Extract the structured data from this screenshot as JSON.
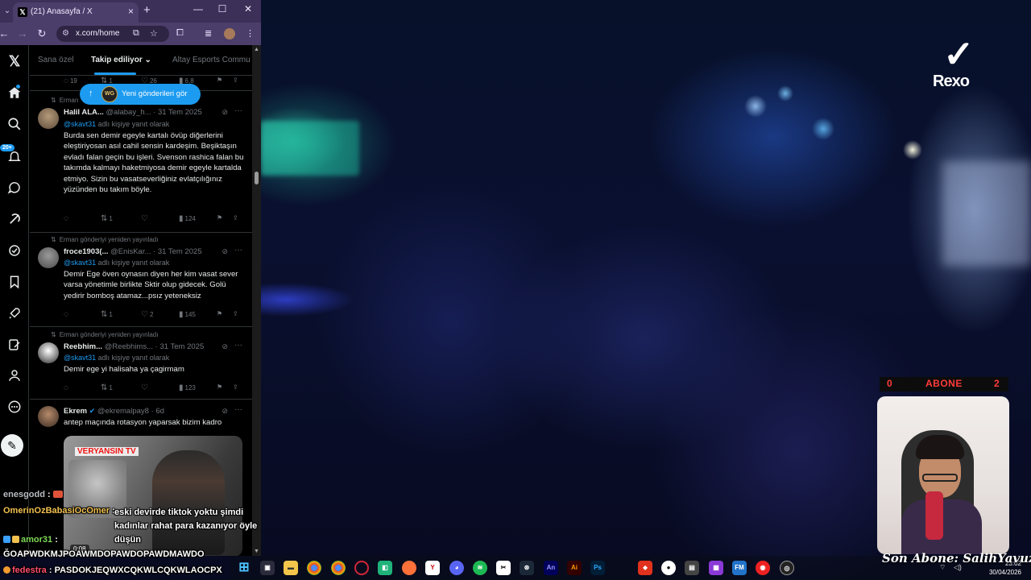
{
  "browser": {
    "tab_title": "(21) Anasayfa / X",
    "url": "x.com/home",
    "tab_favicon": "x-logo",
    "controls": {
      "new_tab": "+",
      "minimize": "—",
      "maximize": "☐",
      "close": "✕"
    }
  },
  "x": {
    "feed_tabs": [
      "Sana özel",
      "Takip ediliyor",
      "Altay Esports Commu"
    ],
    "active_tab": "Takip ediliyor",
    "notification_badge": "20+",
    "new_posts_pill": "Yeni gönderileri gör",
    "new_posts_avatar": "WG",
    "top_actions": {
      "replies": "19",
      "reposts": "1",
      "likes": "26",
      "views": "6,8"
    },
    "posts": [
      {
        "repost_by": "Erman",
        "name": "Halil ALA...",
        "handle": "@alabay_h...",
        "time": "31 Tem 2025",
        "reply_mention": "@skavt31",
        "reply_suffix": "adlı kişiye yanıt olarak",
        "text": "Burda sen demir egeyle kartalı övüp diğerlerini eleştiriyosan asıl cahil sensin kardeşim. Beşiktaşın evladı falan geçin bu işleri. Svenson rashica falan bu takımda kalmayı haketmiyosa demir egeyle kartalda etmiyo. Sizin bu vasatseverliğiniz evlatçılığınız yüzünden bu takım böyle.",
        "actions": {
          "replies": "",
          "reposts": "1",
          "likes": "",
          "views": "124"
        }
      },
      {
        "repost_by": "Erman gönderiyi yeniden yayınladı",
        "name": "froce1903(...",
        "handle": "@EnisKar...",
        "time": "31 Tem 2025",
        "reply_mention": "@skavt31",
        "reply_suffix": "adlı kişiye yanıt olarak",
        "text": "Demir Ege öven oynasın diyen her kim vasat sever varsa yönetimle birlikte Sktir olup gidecek. Golü yedirir bomboş atamaz...psız yeteneksiz",
        "actions": {
          "replies": "",
          "reposts": "1",
          "likes": "2",
          "views": "145"
        }
      },
      {
        "repost_by": "Erman gönderiyi yeniden yayınladı",
        "name": "Reebhim...",
        "handle": "@Reebhims...",
        "time": "31 Tem 2025",
        "reply_mention": "@skavt31",
        "reply_suffix": "adlı kişiye yanıt olarak",
        "text": "Demir ege yi halisaha ya çagirmam",
        "actions": {
          "replies": "",
          "reposts": "1",
          "likes": "",
          "views": "123"
        }
      },
      {
        "name": "Ekrem",
        "handle": "@ekremalpay8",
        "time": "6d",
        "text": "antep maçında rotasyon yaparsak bizim kadro",
        "media_logo": "VERYANSIN TV",
        "media_time": "0:08"
      }
    ]
  },
  "chat": [
    {
      "user": "enesgodd",
      "message": ""
    },
    {
      "user": "OmerinOzBabasiOcOmer",
      "message": "eski devirde tiktok yoktu şimdi kadınlar rahat para kazanıyor öyle düşün"
    },
    {
      "user": "amor31",
      "message": "ĞOAPWDKMJPOAWMDOPAWDOPAWDMAWDO"
    },
    {
      "user": "fedestra",
      "message": "PASDOKJEQWXCQKWLCQKWLAOCPX"
    }
  ],
  "stream": {
    "brand": "Rexo",
    "sub_counter": {
      "left": "0",
      "label": "ABONE",
      "right": "2"
    },
    "last_sub": "Son Abone: SalihYavuz"
  },
  "taskbar": {
    "time": "23:02",
    "date": "30/04/2026",
    "apps": [
      "windows-start",
      "file-explorer",
      "folder",
      "chrome",
      "chrome-alt",
      "opera",
      "app-green",
      "firefox",
      "app-y",
      "discord",
      "spotify",
      "capcut",
      "steam",
      "adobe-an",
      "adobe-ai",
      "adobe-ps",
      "acrobat",
      "app-ball",
      "video-editor",
      "app-purple",
      "app-fm",
      "app-red",
      "obs"
    ]
  },
  "colors": {
    "accent": "#1d9bf0",
    "browser_chrome": "#4c3e6a",
    "counter_red": "#ff3b3b"
  }
}
